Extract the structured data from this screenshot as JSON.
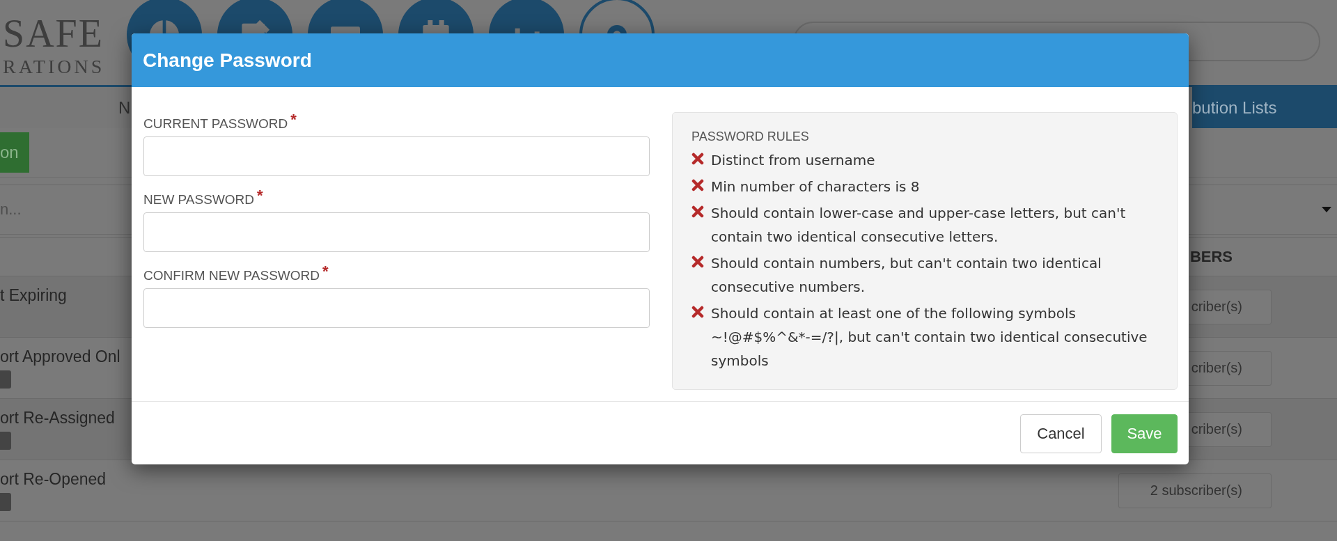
{
  "header": {
    "logo_lines": [
      "SAFE",
      "RATIONS"
    ],
    "icon_buttons": [
      {
        "selected": false
      },
      {
        "selected": false
      },
      {
        "selected": false
      },
      {
        "selected": false
      },
      {
        "selected": false
      },
      {
        "selected": true
      }
    ]
  },
  "nav_tabs": [
    {
      "label": "N",
      "selected": false
    },
    {
      "label": "bution Lists",
      "selected": true
    }
  ],
  "toolbar": {
    "button": "on"
  },
  "filter": {
    "placeholder": "n..."
  },
  "table": {
    "columns": [
      "BERS"
    ],
    "rows": [
      {
        "name": "t Expiring",
        "tagged": false,
        "subscribers": "criber(s)"
      },
      {
        "name": "ort Approved Onl",
        "tagged": true,
        "subscribers": "criber(s)"
      },
      {
        "name": "ort Re-Assigned",
        "tagged": true,
        "subscribers": "criber(s)"
      },
      {
        "name": "ort Re-Opened",
        "tagged": true,
        "subscribers": "2 subscriber(s)"
      }
    ]
  },
  "modal": {
    "title": "Change Password",
    "required_mark": "*",
    "fields": [
      {
        "label": "CURRENT PASSWORD",
        "required": true
      },
      {
        "label": "NEW PASSWORD",
        "required": true
      },
      {
        "label": "CONFIRM NEW PASSWORD",
        "required": true
      }
    ],
    "rules_title": "PASSWORD RULES",
    "rules": [
      {
        "text": "Distinct from username",
        "met": false
      },
      {
        "text": "Min number of characters is 8",
        "met": false
      },
      {
        "text": "Should contain lower-case and upper-case letters, but can't contain two identical consecutive letters.",
        "met": false
      },
      {
        "text": "Should contain numbers, but can't contain two identical consecutive numbers.",
        "met": false
      },
      {
        "text": "Should contain at least one of the following symbols ~!@#$%^&*-=/?|, but can't contain two identical consecutive symbols",
        "met": false
      }
    ],
    "buttons": [
      {
        "label": "Cancel",
        "kind": "default"
      },
      {
        "label": "Save",
        "kind": "primary"
      }
    ]
  }
}
